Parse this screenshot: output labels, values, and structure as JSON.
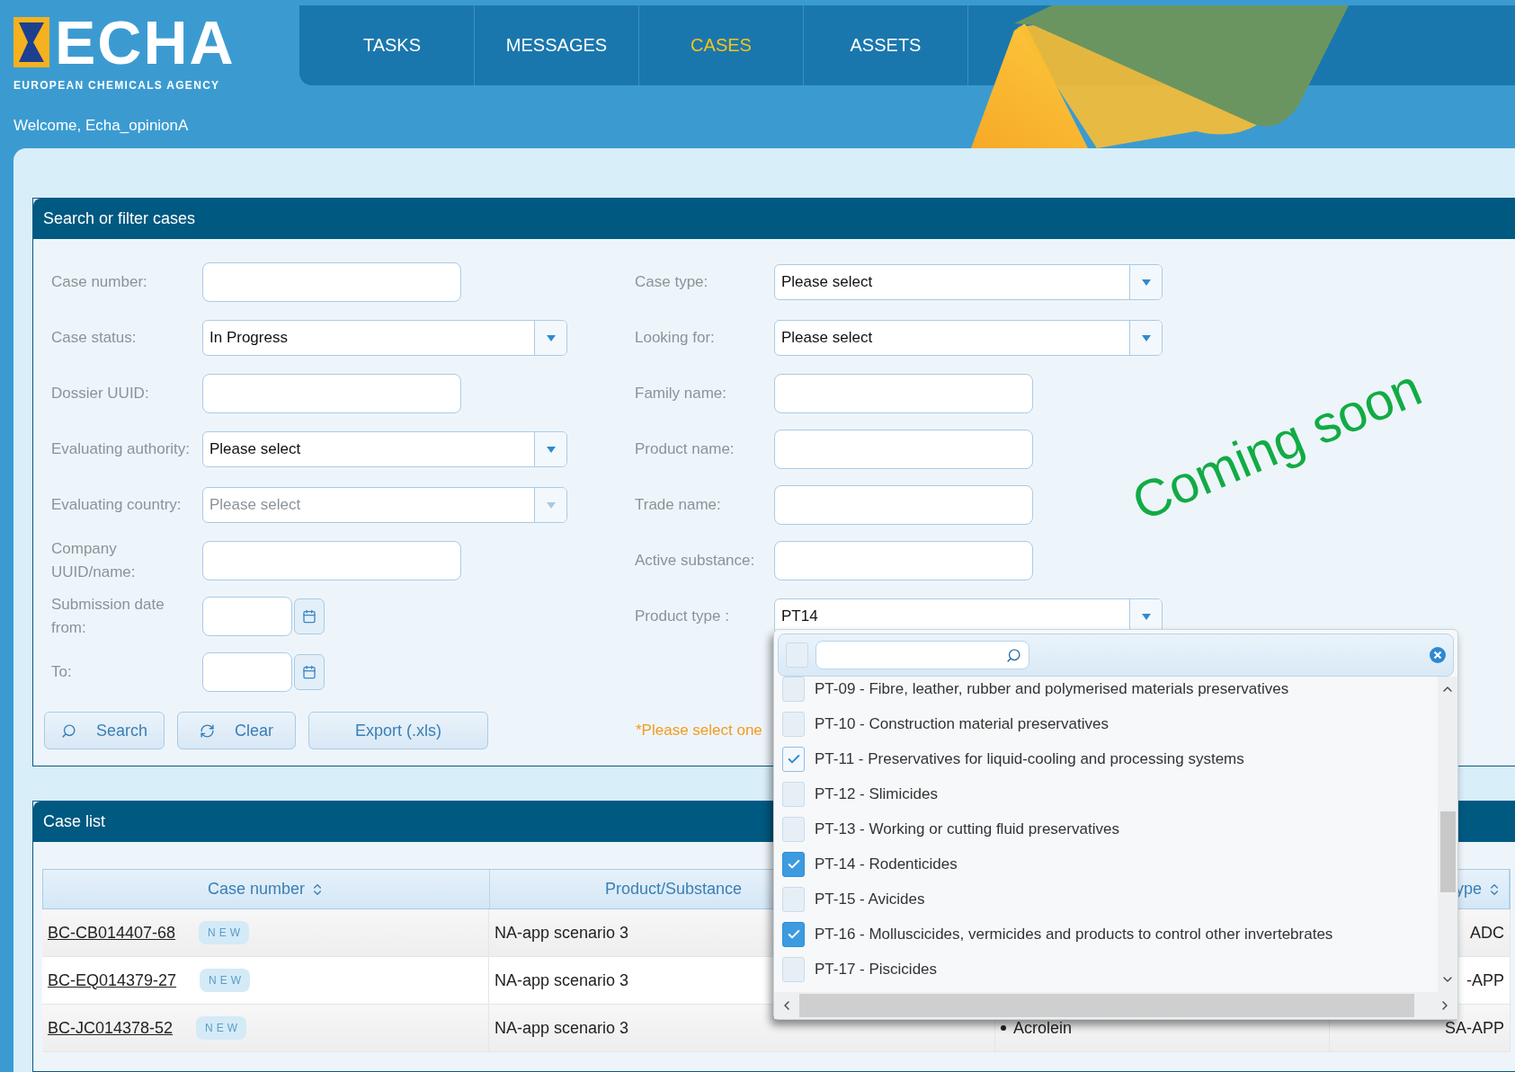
{
  "header": {
    "logo": {
      "name": "ECHA",
      "subtitle": "EUROPEAN CHEMICALS AGENCY"
    },
    "tabs": [
      {
        "label": "TASKS",
        "selected": false
      },
      {
        "label": "MESSAGES",
        "selected": false
      },
      {
        "label": "CASES",
        "selected": true
      },
      {
        "label": "ASSETS",
        "selected": false
      }
    ],
    "welcome": "Welcome, Echa_opinionA"
  },
  "search_panel": {
    "title": "Search or filter cases",
    "left_fields": [
      {
        "label": "Case number:",
        "kind": "text",
        "disabled": false
      },
      {
        "label": "Case status:",
        "kind": "select",
        "value": "In Progress",
        "disabled": false
      },
      {
        "label": "Dossier UUID:",
        "kind": "text",
        "disabled": false
      },
      {
        "label": "Evaluating authority:",
        "kind": "select",
        "value": "Please select",
        "disabled": false
      },
      {
        "label": "Evaluating country:",
        "kind": "select",
        "value": "Please select",
        "disabled": true
      },
      {
        "label": "Company UUID/name:",
        "kind": "text",
        "disabled": false
      },
      {
        "label": "Submission date from:",
        "kind": "date",
        "disabled": false
      },
      {
        "label": "To:",
        "kind": "date",
        "disabled": false
      }
    ],
    "right_fields": [
      {
        "label": "Case type:",
        "kind": "select",
        "value": "Please select",
        "disabled": false
      },
      {
        "label": "Looking for:",
        "kind": "select",
        "value": "Please select",
        "disabled": false
      },
      {
        "label": "Family name:",
        "kind": "text",
        "disabled": false
      },
      {
        "label": "Product name:",
        "kind": "text",
        "disabled": false
      },
      {
        "label": "Trade name:",
        "kind": "text",
        "disabled": false
      },
      {
        "label": "Active substance:",
        "kind": "text",
        "disabled": false
      },
      {
        "label": "Product type :",
        "kind": "select",
        "value": "PT14",
        "disabled": false
      }
    ],
    "buttons": [
      {
        "label": "Search",
        "kind": "search"
      },
      {
        "label": "Clear",
        "kind": "clear"
      },
      {
        "label": "Export (.xls)",
        "kind": "plain"
      }
    ],
    "note": "*Please select one"
  },
  "product_type_dropdown": {
    "select_all_checked": false,
    "items": [
      {
        "label": "PT-09 - Fibre, leather, rubber and polymerised materials preservatives",
        "checked": false
      },
      {
        "label": "PT-10 - Construction material preservatives",
        "checked": false
      },
      {
        "label": "PT-11 - Preservatives for liquid-cooling and processing systems",
        "checked": true
      },
      {
        "label": "PT-12 - Slimicides",
        "checked": false
      },
      {
        "label": "PT-13 - Working or cutting fluid preservatives",
        "checked": false
      },
      {
        "label": "PT-14 - Rodenticides",
        "checked": true
      },
      {
        "label": "PT-15 - Avicides",
        "checked": false
      },
      {
        "label": "PT-16 - Molluscicides, vermicides and products to control other invertebrates",
        "checked": true
      },
      {
        "label": "PT-17 - Piscicides",
        "checked": false
      }
    ]
  },
  "case_list": {
    "title": "Case list",
    "headers": {
      "case_number": "Case number",
      "product": "Product/Substance",
      "column_4": "ype"
    },
    "rows": [
      {
        "case_number": "BC-CB014407-68",
        "badge": "NEW",
        "product": "NA-app scenario 3",
        "column_4": "ADC"
      },
      {
        "case_number": "BC-EQ014379-27",
        "badge": "NEW",
        "product": "NA-app scenario 3",
        "column_4": "-APP"
      },
      {
        "case_number": "BC-JC014378-52",
        "badge": "NEW",
        "product": "NA-app scenario 3",
        "substance": "Acrolein",
        "column_4": "SA-APP"
      }
    ]
  },
  "annotation": "Coming soon"
}
